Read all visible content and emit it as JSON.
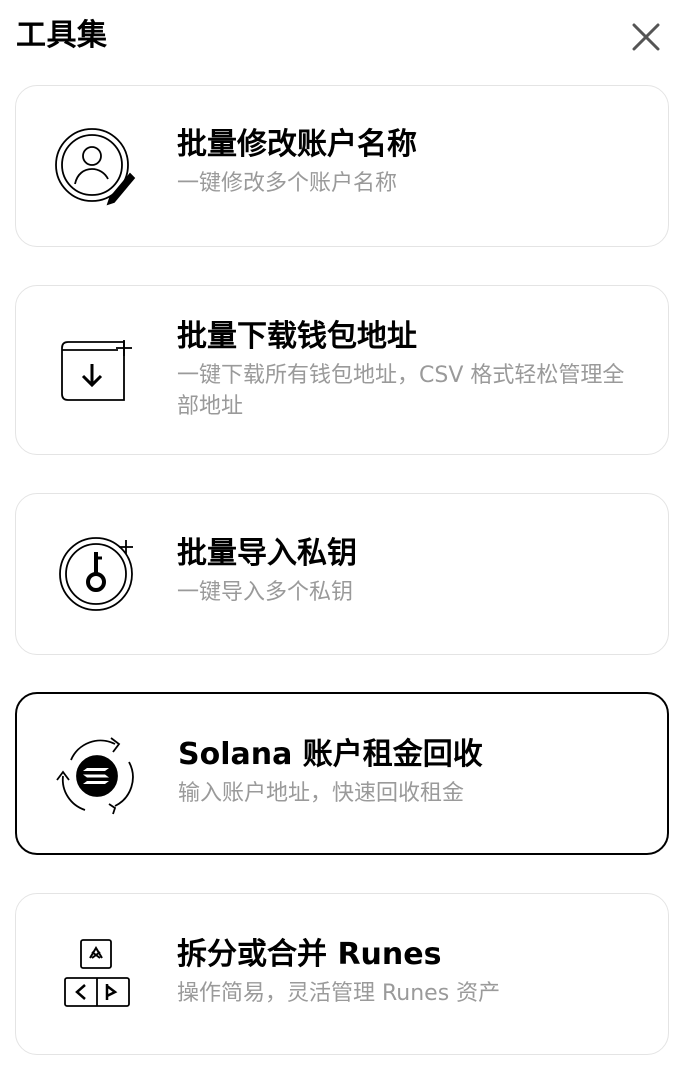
{
  "header": {
    "title": "工具集",
    "close_icon": "close-icon"
  },
  "colors": {
    "border": "#e4e4e4",
    "selected_border": "#000000",
    "description_text": "#9a9a9a",
    "title_text": "#000000"
  },
  "tools": [
    {
      "icon": "user-edit-icon",
      "title": "批量修改账户名称",
      "description": "一键修改多个账户名称",
      "selected": false
    },
    {
      "icon": "download-address-icon",
      "title": "批量下载钱包地址",
      "description": "一键下载所有钱包地址，CSV 格式轻松管理全部地址",
      "selected": false
    },
    {
      "icon": "key-import-icon",
      "title": "批量导入私钥",
      "description": "一键导入多个私钥",
      "selected": false
    },
    {
      "icon": "solana-recycle-icon",
      "title": "Solana 账户租金回收",
      "description": "输入账户地址，快速回收租金",
      "selected": true
    },
    {
      "icon": "runes-split-merge-icon",
      "title": "拆分或合并 Runes",
      "description": "操作简易，灵活管理 Runes 资产",
      "selected": false
    }
  ]
}
